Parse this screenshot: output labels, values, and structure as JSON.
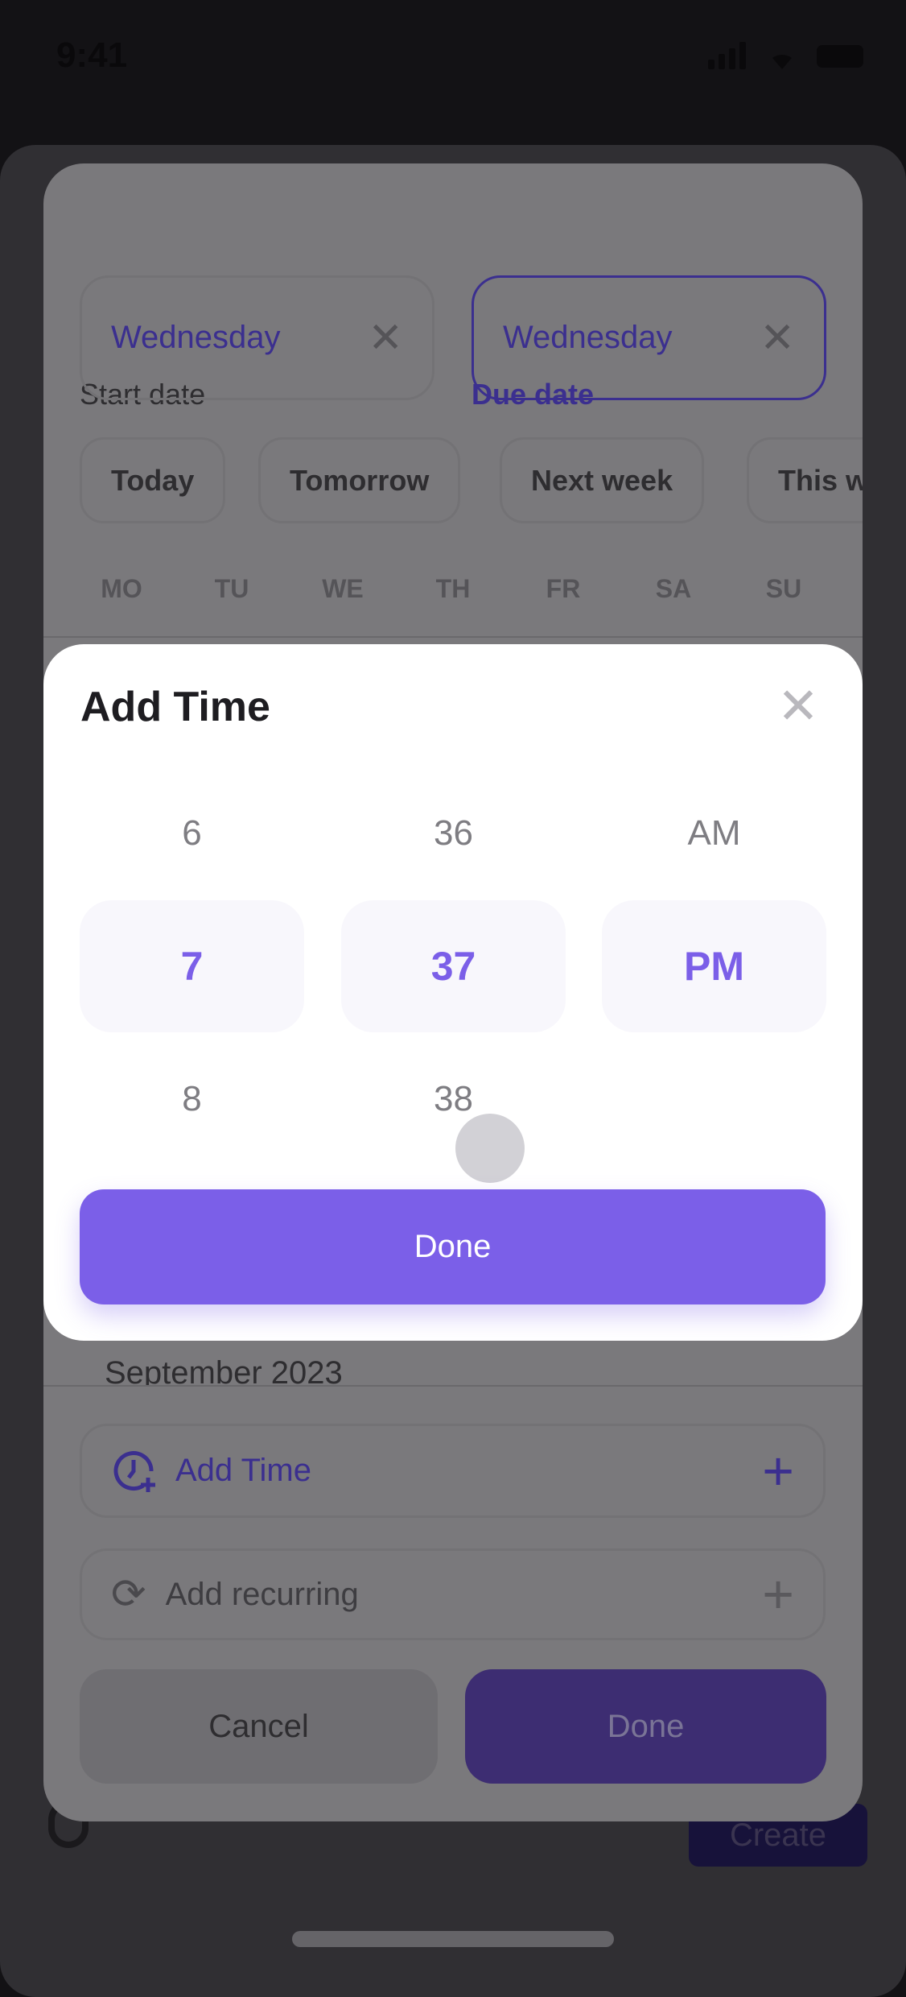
{
  "status_bar": {
    "time": "9:41"
  },
  "date_sheet": {
    "start_label": "Start date",
    "due_label": "Due date",
    "start_value": "Wednesday",
    "due_value": "Wednesday",
    "quick_chips": [
      "Today",
      "Tomorrow",
      "Next week",
      "This w"
    ],
    "weekdays": [
      "MO",
      "TU",
      "WE",
      "TH",
      "FR",
      "SA",
      "SU"
    ],
    "month": "September 2023",
    "add_time_label": "Add Time",
    "add_recurring_label": "Add recurring",
    "cancel_label": "Cancel",
    "done_label": "Done"
  },
  "footer": {
    "create_label": "Create"
  },
  "time_modal": {
    "title": "Add Time",
    "hours": {
      "prev": "6",
      "selected": "7",
      "next": "8"
    },
    "minutes": {
      "prev": "36",
      "selected": "37",
      "next": "38"
    },
    "period": {
      "prev": "AM",
      "selected": "PM"
    },
    "done_label": "Done"
  },
  "colors": {
    "accent": "#7b5fe8",
    "selected_bg": "#f8f7fc"
  }
}
